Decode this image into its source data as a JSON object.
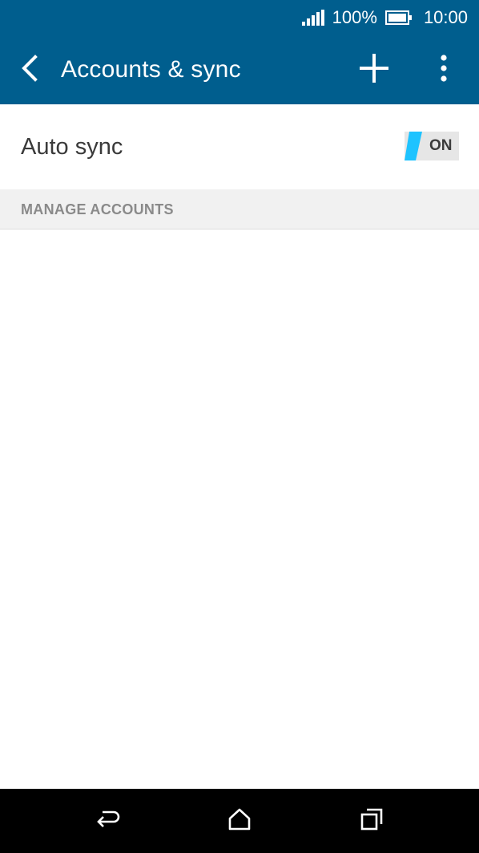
{
  "status_bar": {
    "battery_percent": "100%",
    "time": "10:00",
    "icons": [
      "signal-icon",
      "battery-icon"
    ]
  },
  "app_bar": {
    "title": "Accounts & sync",
    "icons": [
      "back-arrow-icon",
      "plus-icon",
      "more-vert-icon"
    ]
  },
  "auto_sync": {
    "label": "Auto sync",
    "toggle_state": "ON"
  },
  "section": {
    "header": "MANAGE ACCOUNTS"
  },
  "nav_bar": {
    "icons": [
      "back-icon",
      "home-icon",
      "recents-icon"
    ]
  },
  "colors": {
    "primary": "#005e8e",
    "toggle_accent": "#1ec3ff",
    "section_bg": "#f1f1f1",
    "nav_bg": "#000000"
  }
}
